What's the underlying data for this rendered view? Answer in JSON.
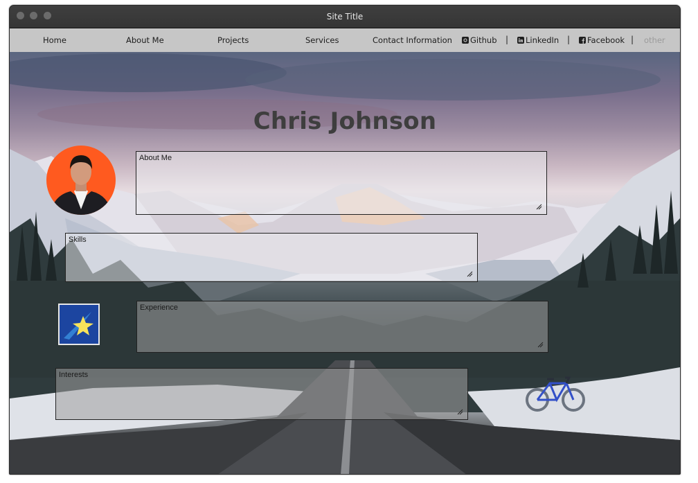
{
  "window": {
    "title": "Site Title"
  },
  "nav": {
    "home": "Home",
    "about": "About Me",
    "projects": "Projects",
    "services": "Services",
    "contact": "Contact Information",
    "github": "Github",
    "linkedin": "LinkedIn",
    "facebook": "Facebook",
    "other": "other",
    "separator": "|"
  },
  "hero": {
    "name": "Chris Johnson"
  },
  "sections": {
    "about": "About Me",
    "skills": "Skills",
    "experience": "Experience",
    "interests": "Interests"
  },
  "icons": {
    "github": "github-icon",
    "linkedin": "linkedin-icon",
    "facebook": "facebook-icon",
    "avatar": "profile-photo",
    "star": "shooting-star-icon",
    "bicycle": "bicycle-icon"
  },
  "colors": {
    "avatar_bg": "#ff5a1f",
    "navbar_bg": "#c6c6c6",
    "titlebar_bg": "#3a3a3a",
    "heading": "#3e3e3e"
  }
}
